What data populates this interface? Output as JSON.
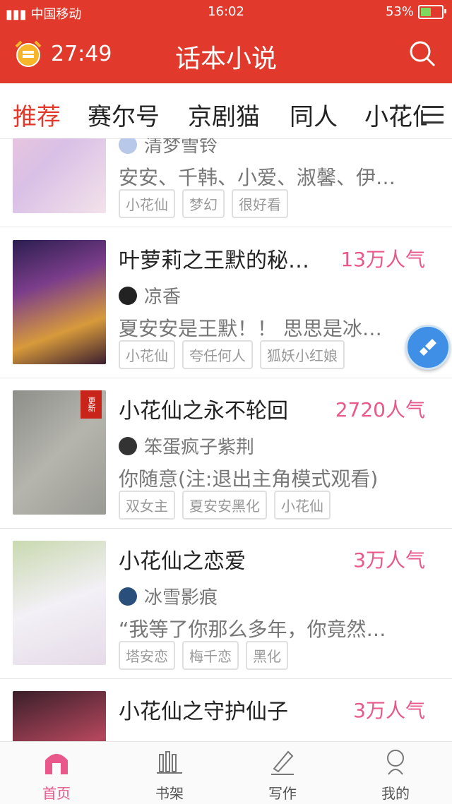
{
  "status": {
    "carrier": "中国移动",
    "time": "16:02",
    "battery": "53%"
  },
  "appbar": {
    "timer": "27:49",
    "title": "话本小说"
  },
  "tabs": [
    "推荐",
    "赛尔号",
    "京剧猫",
    "同人",
    "小花仙"
  ],
  "books": [
    {
      "title": "",
      "popularity": "",
      "author": "清梦雪铃",
      "desc": "安安、千韩、小爱、淑馨、伊…",
      "tags": [
        "小花仙",
        "梦幻",
        "很好看"
      ],
      "badge": ""
    },
    {
      "title": "叶萝莉之王默的秘…",
      "popularity": "13万人气",
      "author": "凉香",
      "desc": "夏安安是王默！！ 思思是冰公…",
      "tags": [
        "小花仙",
        "夸任何人",
        "狐妖小红娘"
      ],
      "badge": ""
    },
    {
      "title": "小花仙之永不轮回",
      "popularity": "2720人气",
      "author": "笨蛋疯子紫荆",
      "desc": "你随意(注:退出主角模式观看)",
      "tags": [
        "双女主",
        "夏安安黑化",
        "小花仙"
      ],
      "badge": "更新"
    },
    {
      "title": "小花仙之恋爱",
      "popularity": "3万人气",
      "author": "冰雪影痕",
      "desc": "“我等了你那么多年，你竟然…",
      "tags": [
        "塔安恋",
        "梅千恋",
        "黑化"
      ],
      "badge": ""
    },
    {
      "title": "小花仙之守护仙子",
      "popularity": "3万人气",
      "author": "",
      "desc": "",
      "tags": [],
      "badge": ""
    }
  ],
  "nav": {
    "home": "首页",
    "shelf": "书架",
    "write": "写作",
    "mine": "我的"
  },
  "colors": {
    "brand": "#e13a2c",
    "popularity": "#e9588a"
  }
}
